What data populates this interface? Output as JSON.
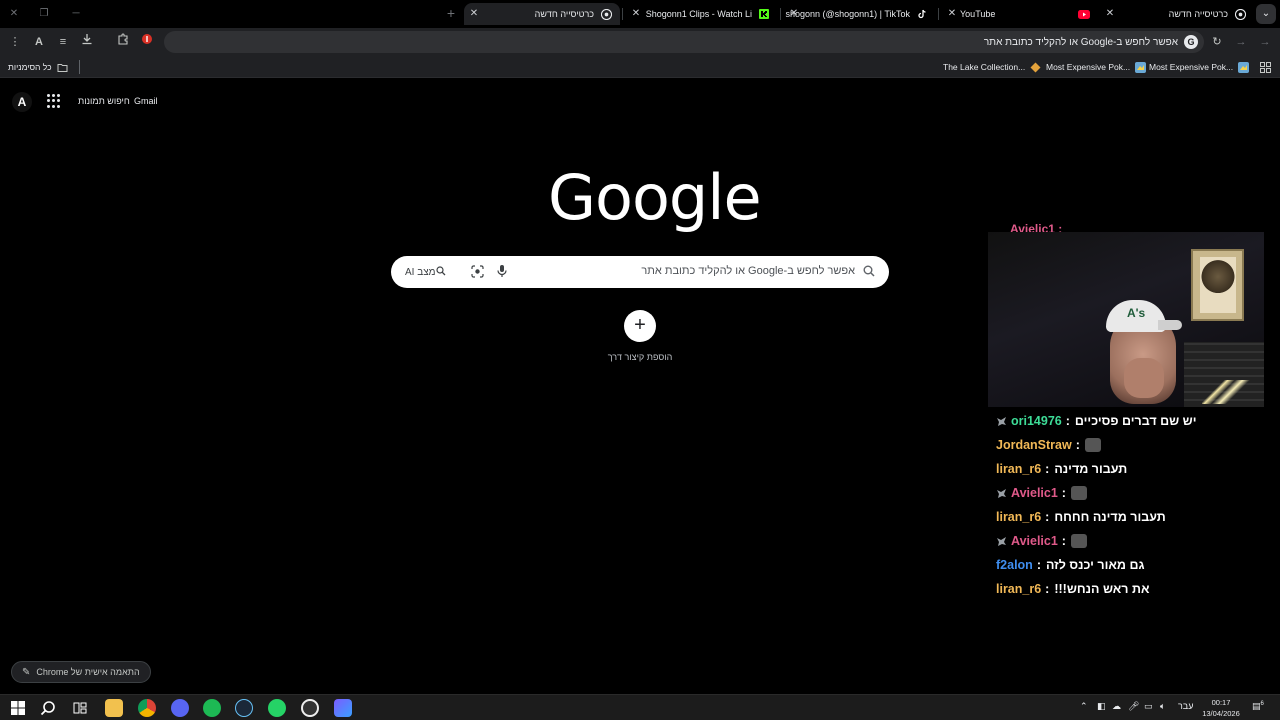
{
  "tabs": [
    {
      "title": "כרטיסייה חדשה",
      "favicon": "chrome-icon",
      "active": false
    },
    {
      "title": "YouTube",
      "favicon": "youtube-icon",
      "active": false
    },
    {
      "title": "shogonn (@shogonn1) | TikTok",
      "favicon": "tiktok-icon",
      "active": false
    },
    {
      "title": "Shogonn1 Clips - Watch Li",
      "favicon": "kick-icon",
      "active": false
    },
    {
      "title": "כרטיסייה חדשה",
      "favicon": "chrome-icon",
      "active": true
    }
  ],
  "omnibox": {
    "text": "אפשר לחפש ב-Google או להקליד כתובת אתר"
  },
  "bookmarks": {
    "all_bookmarks": "כל הסימניות",
    "items": [
      {
        "label": "Most Expensive Pok..."
      },
      {
        "label": "Most Expensive Pok..."
      },
      {
        "label": "The Lake Collection..."
      }
    ]
  },
  "header": {
    "gmail": "Gmail",
    "images": "חיפוש תמונות",
    "avatar_letter": "A"
  },
  "logo": "Google",
  "search": {
    "placeholder": "אפשר לחפש ב-Google או להקליד כתובת אתר",
    "ai_mode": "מצב AI"
  },
  "shortcuts": {
    "add_label": "הוספת קיצור דרך",
    "add_symbol": "+"
  },
  "customize": {
    "label": "התאמה אישית של Chrome"
  },
  "stream_chat": [
    {
      "user": "ori14976",
      "user_color": "#3ddc97",
      "badge": true,
      "message": "יש שם דברים פסיכיים",
      "emote": false
    },
    {
      "user": "JordanStraw",
      "user_color": "#f2b957",
      "badge": false,
      "message": "",
      "emote": true
    },
    {
      "user": "liran_r6",
      "user_color": "#f2b957",
      "badge": false,
      "message": "תעבור מדינה",
      "emote": false
    },
    {
      "user": "Avielic1",
      "user_color": "#e05a8a",
      "badge": true,
      "message": "",
      "emote": true
    },
    {
      "user": "liran_r6",
      "user_color": "#f2b957",
      "badge": false,
      "message": "תעבור מדינה חחחח",
      "emote": false
    },
    {
      "user": "Avielic1",
      "user_color": "#e05a8a",
      "badge": true,
      "message": "",
      "emote": true
    },
    {
      "user": "f2alon",
      "user_color": "#3f8ef0",
      "badge": false,
      "message": "גם מאור יכנס לזה",
      "emote": false
    },
    {
      "user": "liran_r6",
      "user_color": "#f2b957",
      "badge": false,
      "message": "את ראש הנחש!!!",
      "emote": false
    }
  ],
  "stream_partial": "Avielic1 :",
  "taskbar": {
    "lang": "עבר",
    "time": "00:17",
    "date": "13/04/2026",
    "notif_count": "6"
  },
  "colors": {
    "page_bg": "#000000",
    "toolbar_bg": "#202124",
    "omnibox_bg": "#303134",
    "searchbox_bg": "#ffffff"
  }
}
